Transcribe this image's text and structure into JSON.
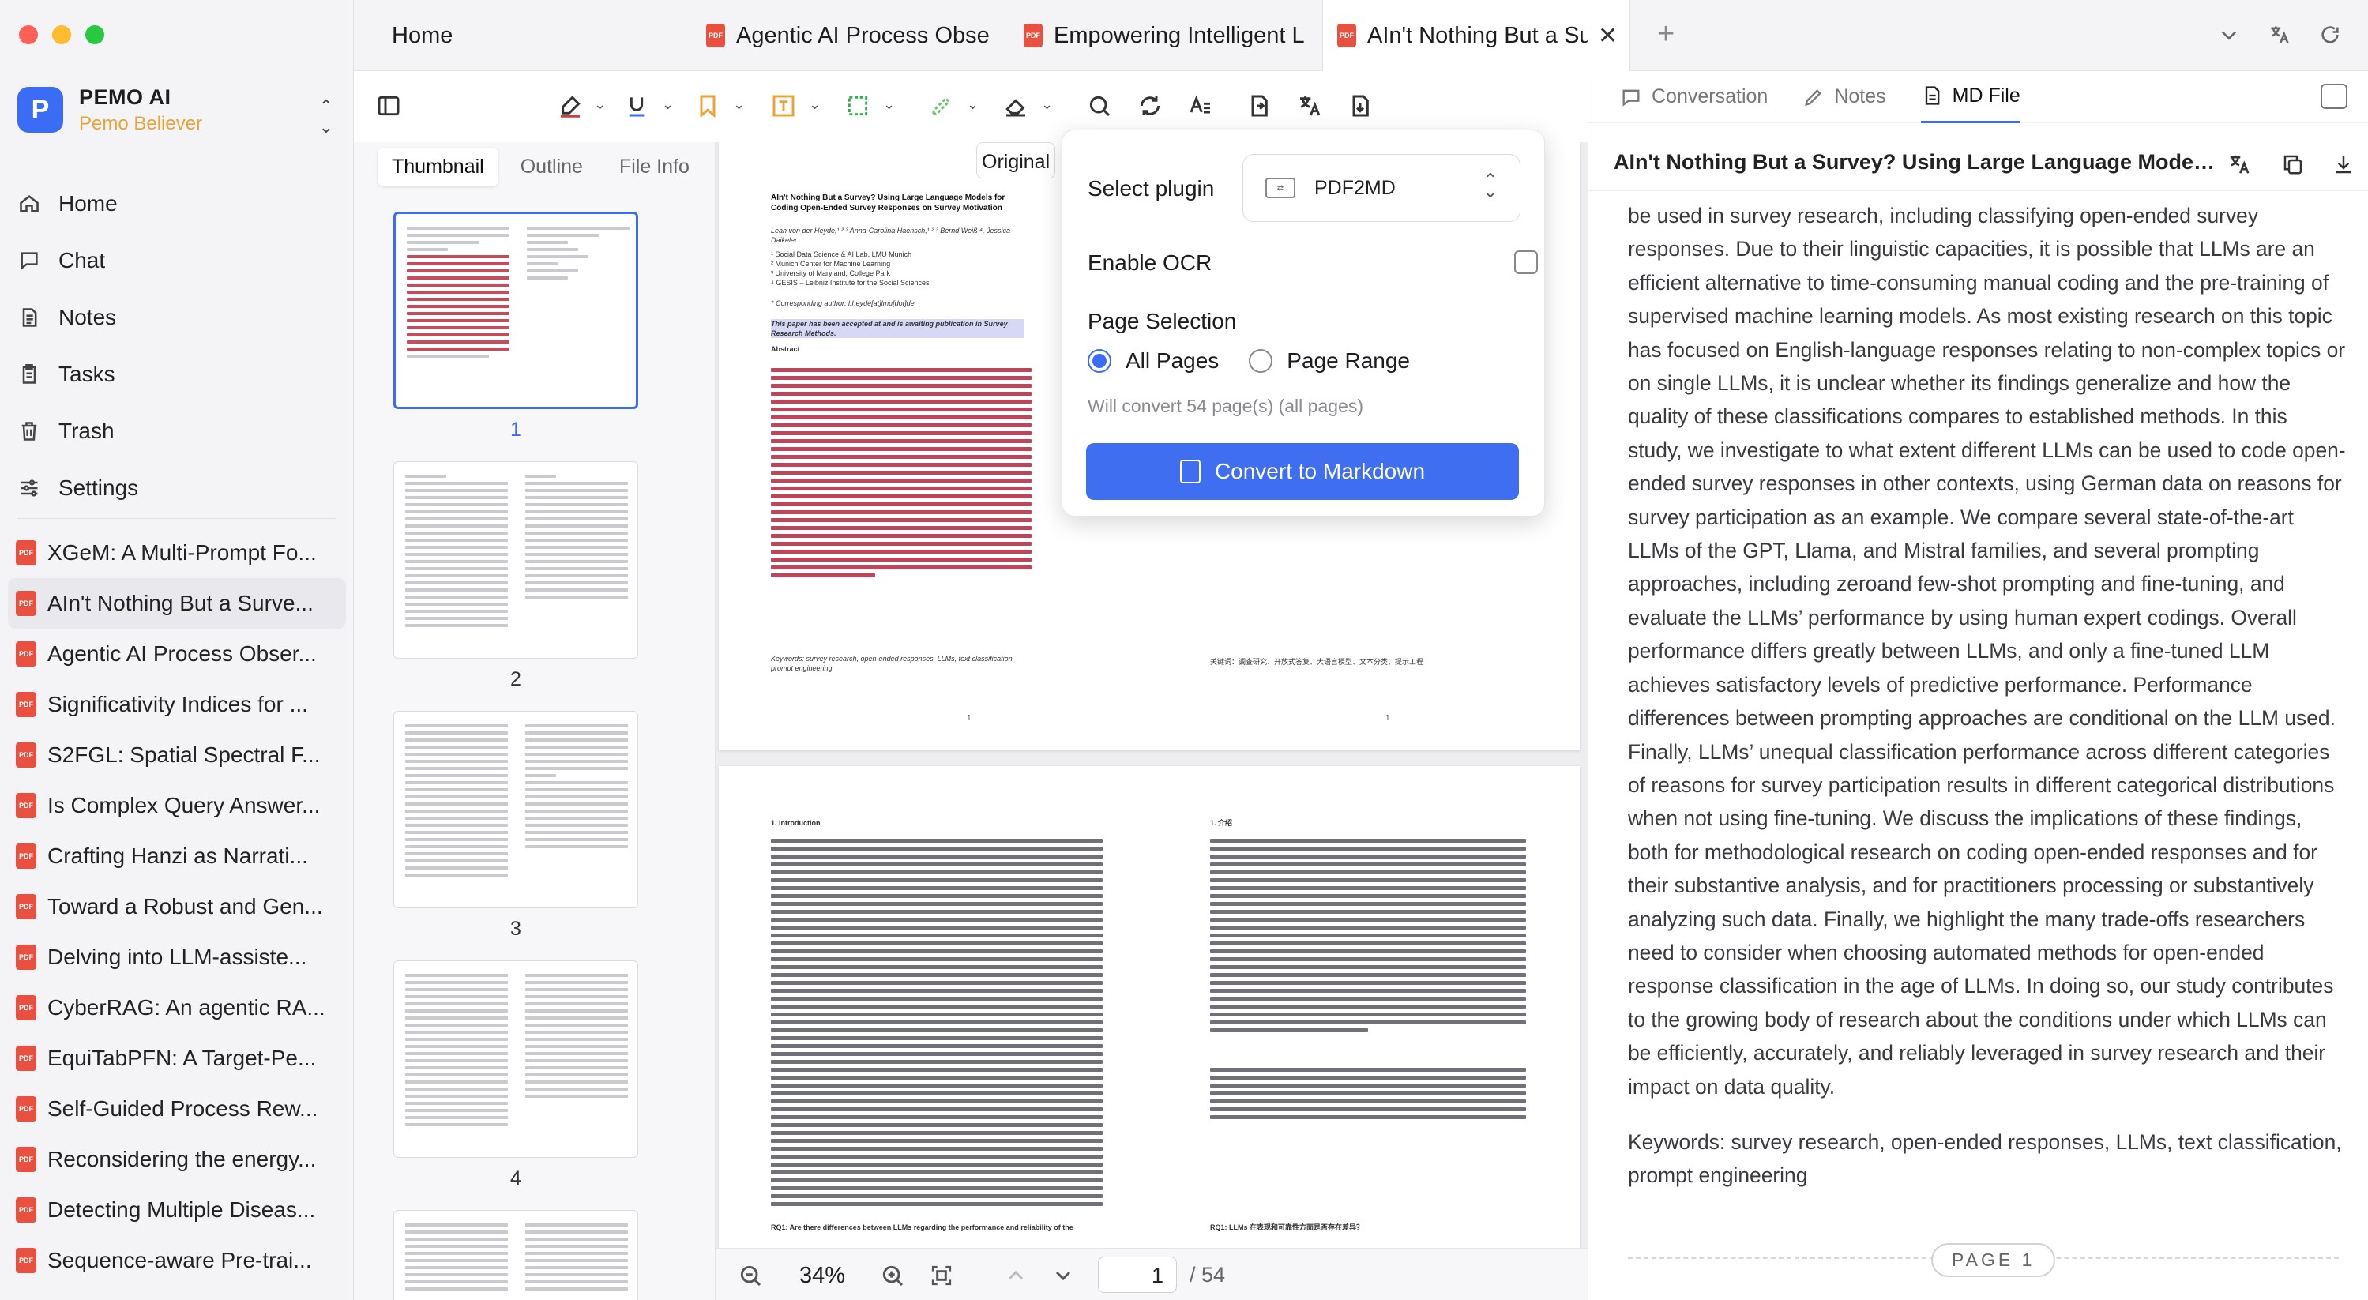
{
  "sidebar": {
    "brand": {
      "name": "PEMO AI",
      "subtitle": "Pemo Believer"
    },
    "nav": [
      {
        "label": "Home",
        "icon": "home-icon"
      },
      {
        "label": "Chat",
        "icon": "chat-icon"
      },
      {
        "label": "Notes",
        "icon": "notes-icon"
      },
      {
        "label": "Tasks",
        "icon": "tasks-icon"
      },
      {
        "label": "Trash",
        "icon": "trash-icon"
      },
      {
        "label": "Settings",
        "icon": "settings-icon"
      }
    ],
    "documents": [
      "XGeM: A Multi-Prompt Fo...",
      "AIn't Nothing But a Surve...",
      "Agentic AI Process Obser...",
      "Significativity Indices for ...",
      "S2FGL: Spatial Spectral F...",
      "Is Complex Query Answer...",
      "Crafting Hanzi as Narrati...",
      "Toward a Robust and Gen...",
      "Delving into LLM-assiste...",
      "CyberRAG: An agentic RA...",
      "EquiTabPFN: A Target-Pe...",
      "Self-Guided Process Rew...",
      "Reconsidering the energy...",
      "Detecting Multiple Diseas...",
      "Sequence-aware Pre-trai..."
    ],
    "active_document_index": 1
  },
  "tabs": {
    "home": "Home",
    "items": [
      {
        "label": "Agentic AI Process Obse"
      },
      {
        "label": "Empowering Intelligent L"
      },
      {
        "label": "AIn't Nothing But a Su"
      }
    ],
    "add": "+"
  },
  "thumbnails": {
    "tabs": [
      "Thumbnail",
      "Outline",
      "File Info"
    ],
    "pages": [
      "1",
      "2",
      "3",
      "4"
    ]
  },
  "pdf": {
    "original_tab": "Original",
    "page1": {
      "title": "AIn't Nothing But a Survey? Using Large Language Models for Coding Open-Ended Survey Responses on Survey Motivation",
      "authors": "Leah von der Heyde,¹ ² ³ Anna-Carolina Haensch,¹ ² ³ Bernd Weiß ⁴, Jessica Daikeler",
      "affiliations": "¹ Social Data Science & AI Lab, LMU Munich\n² Munich Center for Machine Learning\n³ University of Maryland, College Park\n⁴ GESIS – Leibniz Institute for the Social Sciences",
      "corresponding": "* Corresponding author: l.heyde[at]lmu[dot]de",
      "accepted": "This paper has been accepted at and is awaiting publication in Survey Research Methods.",
      "abstract_heading": "Abstract",
      "keywords": "Keywords: survey research, open-ended responses, LLMs, text classification, prompt engineering",
      "zh_keywords": "关键词：调查研究、开放式答复、大语言模型、文本分类、提示工程",
      "num": "1"
    },
    "page2": {
      "section_en": "1.    Introduction",
      "section_zh": "1. 介绍",
      "rq_en": "RQ1: Are there differences between LLMs regarding the performance and reliability of the",
      "rq_zh": "RQ1: LLMs 在表现和可靠性方面是否存在差异？"
    },
    "zoom": "34%",
    "current_page": "1",
    "total_pages": "/ 54"
  },
  "plugin_popup": {
    "select_label": "Select plugin",
    "selected_plugin": "PDF2MD",
    "ocr_label": "Enable OCR",
    "ocr_checked": false,
    "page_selection_label": "Page Selection",
    "options": [
      "All Pages",
      "Page Range"
    ],
    "selected_option": "All Pages",
    "hint": "Will convert 54 page(s) (all pages)",
    "button": "Convert to Markdown",
    "accent": "#3f6ef0"
  },
  "right_panel": {
    "tabs": [
      "Conversation",
      "Notes",
      "MD File"
    ],
    "active_tab": "MD File",
    "title": "AIn't Nothing But a Survey? Using Large Language Models for Coding Open-Ended Survey Responses",
    "paragraphs": [
      "be used in survey research, including classifying open-ended survey responses. Due to their linguistic capacities, it is possible that LLMs are an efficient alternative to time-consuming manual coding and the pre-training of supervised machine learning models. As most existing research on this topic has focused on English-language responses relating to non-complex topics or on single LLMs, it is unclear whether its findings generalize and how the quality of these classifications compares to established methods. In this study, we investigate to what extent different LLMs can be used to code open-ended survey responses in other contexts, using German data on reasons for survey participation as an example. We compare several state-of-the-art LLMs of the GPT, Llama, and Mistral families, and several prompting approaches, including zeroand few-shot prompting and fine-tuning, and evaluate the LLMs’ performance by using human expert codings. Overall performance differs greatly between LLMs, and only a fine-tuned LLM achieves satisfactory levels of predictive performance. Performance differences between prompting approaches are conditional on the LLM used. Finally, LLMs’ unequal classification performance across different categories of reasons for survey participation results in different categorical distributions when not using fine-tuning. We discuss the implications of these findings, both for methodological research on coding open-ended responses and for their substantive analysis, and for practitioners processing or substantively analyzing such data. Finally, we highlight the many trade-offs researchers need to consider when choosing automated methods for open-ended response classification in the age of LLMs. In doing so, our study contributes to the growing body of research about the conditions under which LLMs can be efficiently, accurately, and reliably leveraged in survey research and their impact on data quality.",
      "Keywords: survey research, open-ended responses, LLMs, text classification, prompt engineering"
    ],
    "page_badge": "PAGE 1"
  }
}
